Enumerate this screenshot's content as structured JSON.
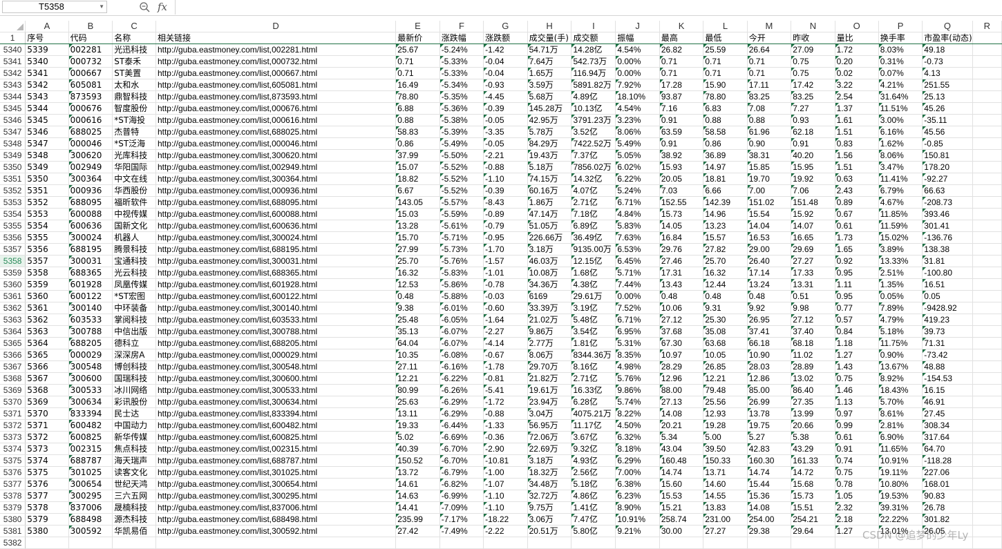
{
  "formula_bar": {
    "name_box": "T5358",
    "fx": "fx",
    "formula": ""
  },
  "col_letters": [
    "A",
    "B",
    "C",
    "D",
    "E",
    "F",
    "G",
    "H",
    "I",
    "J",
    "K",
    "L",
    "M",
    "N",
    "O",
    "P",
    "Q",
    "R"
  ],
  "header_row_num": "1",
  "headers": [
    "序号",
    "代码",
    "名称",
    "相关链接",
    "最新价",
    "涨跌幅",
    "涨跌额",
    "成交量(手)",
    "成交额",
    "振幅",
    "最高",
    "最低",
    "今开",
    "昨收",
    "量比",
    "换手率",
    "市盈率(动态)"
  ],
  "selected_row": "5358",
  "rows": [
    [
      "5340",
      "5339",
      "002281",
      "光迅科技",
      "http://guba.eastmoney.com/list,002281.html",
      "25.67",
      "-5.24%",
      "-1.42",
      "54.71万",
      "14.28亿",
      "4.54%",
      "26.82",
      "25.59",
      "26.64",
      "27.09",
      "1.72",
      "8.03%",
      "49.18"
    ],
    [
      "5341",
      "5340",
      "000732",
      "ST泰禾",
      "http://guba.eastmoney.com/list,000732.html",
      "0.71",
      "-5.33%",
      "-0.04",
      "7.64万",
      "542.73万",
      "0.00%",
      "0.71",
      "0.71",
      "0.71",
      "0.75",
      "0.20",
      "0.31%",
      "-0.73"
    ],
    [
      "5342",
      "5341",
      "000667",
      "ST美置",
      "http://guba.eastmoney.com/list,000667.html",
      "0.71",
      "-5.33%",
      "-0.04",
      "1.65万",
      "116.94万",
      "0.00%",
      "0.71",
      "0.71",
      "0.71",
      "0.75",
      "0.02",
      "0.07%",
      "4.13"
    ],
    [
      "5343",
      "5342",
      "605081",
      "太和水",
      "http://guba.eastmoney.com/list,605081.html",
      "16.49",
      "-5.34%",
      "-0.93",
      "3.59万",
      "5891.82万",
      "7.92%",
      "17.28",
      "15.90",
      "17.11",
      "17.42",
      "3.22",
      "4.21%",
      "251.55"
    ],
    [
      "5344",
      "5343",
      "873593",
      "鼎智科技",
      "http://guba.eastmoney.com/list,873593.html",
      "78.80",
      "-5.35%",
      "-4.45",
      "5.68万",
      "4.89亿",
      "18.10%",
      "93.87",
      "78.80",
      "83.25",
      "83.25",
      "2.54",
      "31.64%",
      "25.13"
    ],
    [
      "5345",
      "5344",
      "000676",
      "智度股份",
      "http://guba.eastmoney.com/list,000676.html",
      "6.88",
      "-5.36%",
      "-0.39",
      "145.28万",
      "10.13亿",
      "4.54%",
      "7.16",
      "6.83",
      "7.08",
      "7.27",
      "1.37",
      "11.51%",
      "45.26"
    ],
    [
      "5346",
      "5345",
      "000616",
      "*ST海投",
      "http://guba.eastmoney.com/list,000616.html",
      "0.88",
      "-5.38%",
      "-0.05",
      "42.95万",
      "3791.23万",
      "3.23%",
      "0.91",
      "0.88",
      "0.88",
      "0.93",
      "1.61",
      "3.00%",
      "-35.11"
    ],
    [
      "5347",
      "5346",
      "688025",
      "杰普特",
      "http://guba.eastmoney.com/list,688025.html",
      "58.83",
      "-5.39%",
      "-3.35",
      "5.78万",
      "3.52亿",
      "8.06%",
      "63.59",
      "58.58",
      "61.96",
      "62.18",
      "1.51",
      "6.16%",
      "45.56"
    ],
    [
      "5348",
      "5347",
      "000046",
      "*ST泛海",
      "http://guba.eastmoney.com/list,000046.html",
      "0.86",
      "-5.49%",
      "-0.05",
      "84.29万",
      "7422.52万",
      "5.49%",
      "0.91",
      "0.86",
      "0.90",
      "0.91",
      "0.83",
      "1.62%",
      "-0.85"
    ],
    [
      "5349",
      "5348",
      "300620",
      "光库科技",
      "http://guba.eastmoney.com/list,300620.html",
      "37.99",
      "-5.50%",
      "-2.21",
      "19.43万",
      "7.37亿",
      "5.05%",
      "38.92",
      "36.89",
      "38.31",
      "40.20",
      "1.56",
      "8.06%",
      "150.81"
    ],
    [
      "5350",
      "5349",
      "002949",
      "华阳国际",
      "http://guba.eastmoney.com/list,002949.html",
      "15.07",
      "-5.52%",
      "-0.88",
      "5.18万",
      "7856.02万",
      "6.02%",
      "15.93",
      "14.97",
      "15.85",
      "15.95",
      "1.51",
      "3.47%",
      "178.20"
    ],
    [
      "5351",
      "5350",
      "300364",
      "中文在线",
      "http://guba.eastmoney.com/list,300364.html",
      "18.82",
      "-5.52%",
      "-1.10",
      "74.15万",
      "14.32亿",
      "6.22%",
      "20.05",
      "18.81",
      "19.70",
      "19.92",
      "0.63",
      "11.41%",
      "-92.27"
    ],
    [
      "5352",
      "5351",
      "000936",
      "华西股份",
      "http://guba.eastmoney.com/list,000936.html",
      "6.67",
      "-5.52%",
      "-0.39",
      "60.16万",
      "4.07亿",
      "5.24%",
      "7.03",
      "6.66",
      "7.00",
      "7.06",
      "2.43",
      "6.79%",
      "66.63"
    ],
    [
      "5353",
      "5352",
      "688095",
      "福昕软件",
      "http://guba.eastmoney.com/list,688095.html",
      "143.05",
      "-5.57%",
      "-8.43",
      "1.86万",
      "2.71亿",
      "6.71%",
      "152.55",
      "142.39",
      "151.02",
      "151.48",
      "0.89",
      "4.67%",
      "-208.73"
    ],
    [
      "5354",
      "5353",
      "600088",
      "中视传媒",
      "http://guba.eastmoney.com/list,600088.html",
      "15.03",
      "-5.59%",
      "-0.89",
      "47.14万",
      "7.18亿",
      "4.84%",
      "15.73",
      "14.96",
      "15.54",
      "15.92",
      "0.67",
      "11.85%",
      "393.46"
    ],
    [
      "5355",
      "5354",
      "600636",
      "国新文化",
      "http://guba.eastmoney.com/list,600636.html",
      "13.28",
      "-5.61%",
      "-0.79",
      "51.05万",
      "6.89亿",
      "5.83%",
      "14.05",
      "13.23",
      "14.04",
      "14.07",
      "0.61",
      "11.59%",
      "301.41"
    ],
    [
      "5356",
      "5355",
      "300024",
      "机器人",
      "http://guba.eastmoney.com/list,300024.html",
      "15.70",
      "-5.71%",
      "-0.95",
      "226.66万",
      "36.49亿",
      "7.63%",
      "16.84",
      "15.57",
      "16.53",
      "16.65",
      "1.73",
      "15.02%",
      "-136.76"
    ],
    [
      "5357",
      "5356",
      "688195",
      "腾景科技",
      "http://guba.eastmoney.com/list,688195.html",
      "27.99",
      "-5.73%",
      "-1.70",
      "3.18万",
      "9135.00万",
      "6.53%",
      "29.76",
      "27.82",
      "29.00",
      "29.69",
      "1.65",
      "3.89%",
      "138.38"
    ],
    [
      "5358",
      "5357",
      "300031",
      "宝通科技",
      "http://guba.eastmoney.com/list,300031.html",
      "25.70",
      "-5.76%",
      "-1.57",
      "46.03万",
      "12.15亿",
      "6.45%",
      "27.46",
      "25.70",
      "26.40",
      "27.27",
      "0.92",
      "13.33%",
      "31.81"
    ],
    [
      "5359",
      "5358",
      "688365",
      "光云科技",
      "http://guba.eastmoney.com/list,688365.html",
      "16.32",
      "-5.83%",
      "-1.01",
      "10.08万",
      "1.68亿",
      "5.71%",
      "17.31",
      "16.32",
      "17.14",
      "17.33",
      "0.95",
      "2.51%",
      "-100.80"
    ],
    [
      "5360",
      "5359",
      "601928",
      "凤凰传媒",
      "http://guba.eastmoney.com/list,601928.html",
      "12.53",
      "-5.86%",
      "-0.78",
      "34.36万",
      "4.38亿",
      "7.44%",
      "13.43",
      "12.44",
      "13.24",
      "13.31",
      "1.11",
      "1.35%",
      "16.51"
    ],
    [
      "5361",
      "5360",
      "600122",
      "*ST宏图",
      "http://guba.eastmoney.com/list,600122.html",
      "0.48",
      "-5.88%",
      "-0.03",
      "6169",
      "29.61万",
      "0.00%",
      "0.48",
      "0.48",
      "0.48",
      "0.51",
      "0.95",
      "0.05%",
      "0.05"
    ],
    [
      "5362",
      "5361",
      "300140",
      "中环装备",
      "http://guba.eastmoney.com/list,300140.html",
      "9.38",
      "-6.01%",
      "-0.60",
      "33.39万",
      "3.19亿",
      "7.52%",
      "10.06",
      "9.31",
      "9.92",
      "9.98",
      "0.77",
      "7.89%",
      "-9428.92"
    ],
    [
      "5363",
      "5362",
      "603533",
      "掌阅科技",
      "http://guba.eastmoney.com/list,603533.html",
      "25.48",
      "-6.05%",
      "-1.64",
      "21.02万",
      "5.48亿",
      "6.71%",
      "27.12",
      "25.30",
      "26.95",
      "27.12",
      "0.57",
      "4.79%",
      "419.23"
    ],
    [
      "5364",
      "5363",
      "300788",
      "中信出版",
      "http://guba.eastmoney.com/list,300788.html",
      "35.13",
      "-6.07%",
      "-2.27",
      "9.86万",
      "3.54亿",
      "6.95%",
      "37.68",
      "35.08",
      "37.41",
      "37.40",
      "0.84",
      "5.18%",
      "39.73"
    ],
    [
      "5365",
      "5364",
      "688205",
      "德科立",
      "http://guba.eastmoney.com/list,688205.html",
      "64.04",
      "-6.07%",
      "-4.14",
      "2.77万",
      "1.81亿",
      "5.31%",
      "67.30",
      "63.68",
      "66.18",
      "68.18",
      "1.18",
      "11.75%",
      "71.31"
    ],
    [
      "5366",
      "5365",
      "000029",
      "深深房A",
      "http://guba.eastmoney.com/list,000029.html",
      "10.35",
      "-6.08%",
      "-0.67",
      "8.06万",
      "8344.36万",
      "8.35%",
      "10.97",
      "10.05",
      "10.90",
      "11.02",
      "1.27",
      "0.90%",
      "-73.42"
    ],
    [
      "5367",
      "5366",
      "300548",
      "博创科技",
      "http://guba.eastmoney.com/list,300548.html",
      "27.11",
      "-6.16%",
      "-1.78",
      "29.70万",
      "8.16亿",
      "4.98%",
      "28.29",
      "26.85",
      "28.03",
      "28.89",
      "1.43",
      "13.67%",
      "48.88"
    ],
    [
      "5368",
      "5367",
      "300600",
      "国瑞科技",
      "http://guba.eastmoney.com/list,300600.html",
      "12.21",
      "-6.22%",
      "-0.81",
      "21.82万",
      "2.71亿",
      "5.76%",
      "12.96",
      "12.21",
      "12.86",
      "13.02",
      "0.75",
      "8.92%",
      "-154.53"
    ],
    [
      "5369",
      "5368",
      "300533",
      "冰川网络",
      "http://guba.eastmoney.com/list,300533.html",
      "80.99",
      "-6.26%",
      "-5.41",
      "19.61万",
      "16.33亿",
      "9.86%",
      "88.00",
      "79.48",
      "85.00",
      "86.40",
      "1.46",
      "18.43%",
      "16.15"
    ],
    [
      "5370",
      "5369",
      "300634",
      "彩讯股份",
      "http://guba.eastmoney.com/list,300634.html",
      "25.63",
      "-6.29%",
      "-1.72",
      "23.94万",
      "6.28亿",
      "5.74%",
      "27.13",
      "25.56",
      "26.99",
      "27.35",
      "1.13",
      "5.70%",
      "46.91"
    ],
    [
      "5371",
      "5370",
      "833394",
      "民士达",
      "http://guba.eastmoney.com/list,833394.html",
      "13.11",
      "-6.29%",
      "-0.88",
      "3.04万",
      "4075.21万",
      "8.22%",
      "14.08",
      "12.93",
      "13.78",
      "13.99",
      "0.97",
      "8.61%",
      "27.45"
    ],
    [
      "5372",
      "5371",
      "600482",
      "中国动力",
      "http://guba.eastmoney.com/list,600482.html",
      "19.33",
      "-6.44%",
      "-1.33",
      "56.95万",
      "11.17亿",
      "4.50%",
      "20.21",
      "19.28",
      "19.75",
      "20.66",
      "0.99",
      "2.81%",
      "308.34"
    ],
    [
      "5373",
      "5372",
      "600825",
      "新华传媒",
      "http://guba.eastmoney.com/list,600825.html",
      "5.02",
      "-6.69%",
      "-0.36",
      "72.06万",
      "3.67亿",
      "6.32%",
      "5.34",
      "5.00",
      "5.27",
      "5.38",
      "0.61",
      "6.90%",
      "317.64"
    ],
    [
      "5374",
      "5373",
      "002315",
      "焦点科技",
      "http://guba.eastmoney.com/list,002315.html",
      "40.39",
      "-6.70%",
      "-2.90",
      "22.69万",
      "9.32亿",
      "8.18%",
      "43.04",
      "39.50",
      "42.83",
      "43.29",
      "0.91",
      "11.65%",
      "64.70"
    ],
    [
      "5375",
      "5374",
      "688787",
      "海天瑞声",
      "http://guba.eastmoney.com/list,688787.html",
      "150.52",
      "-6.70%",
      "-10.81",
      "3.18万",
      "4.93亿",
      "6.29%",
      "160.48",
      "150.33",
      "160.30",
      "161.33",
      "0.74",
      "10.91%",
      "-118.28"
    ],
    [
      "5376",
      "5375",
      "301025",
      "读客文化",
      "http://guba.eastmoney.com/list,301025.html",
      "13.72",
      "-6.79%",
      "-1.00",
      "18.32万",
      "2.56亿",
      "7.00%",
      "14.74",
      "13.71",
      "14.74",
      "14.72",
      "0.75",
      "19.11%",
      "227.06"
    ],
    [
      "5377",
      "5376",
      "300654",
      "世纪天鸿",
      "http://guba.eastmoney.com/list,300654.html",
      "14.61",
      "-6.82%",
      "-1.07",
      "34.48万",
      "5.18亿",
      "6.38%",
      "15.60",
      "14.60",
      "15.44",
      "15.68",
      "0.78",
      "10.80%",
      "168.01"
    ],
    [
      "5378",
      "5377",
      "300295",
      "三六五网",
      "http://guba.eastmoney.com/list,300295.html",
      "14.63",
      "-6.99%",
      "-1.10",
      "32.72万",
      "4.86亿",
      "6.23%",
      "15.53",
      "14.55",
      "15.36",
      "15.73",
      "1.05",
      "19.53%",
      "90.83"
    ],
    [
      "5379",
      "5378",
      "837006",
      "晟楠科技",
      "http://guba.eastmoney.com/list,837006.html",
      "14.41",
      "-7.09%",
      "-1.10",
      "9.75万",
      "1.41亿",
      "8.90%",
      "15.21",
      "13.83",
      "14.08",
      "15.51",
      "2.32",
      "39.31%",
      "26.78"
    ],
    [
      "5380",
      "5379",
      "688498",
      "源杰科技",
      "http://guba.eastmoney.com/list,688498.html",
      "235.99",
      "-7.17%",
      "-18.22",
      "3.06万",
      "7.47亿",
      "10.91%",
      "258.74",
      "231.00",
      "254.00",
      "254.21",
      "2.18",
      "22.22%",
      "301.82"
    ],
    [
      "5381",
      "5380",
      "300592",
      "华凯易佰",
      "http://guba.eastmoney.com/list,300592.html",
      "27.42",
      "-7.49%",
      "-2.22",
      "20.51万",
      "5.80亿",
      "9.21%",
      "30.00",
      "27.27",
      "29.38",
      "29.64",
      "1.27",
      "13.01%",
      "26.05"
    ]
  ],
  "last_row_num": "5382",
  "watermark": "CSDN @追梦的少年Ly"
}
